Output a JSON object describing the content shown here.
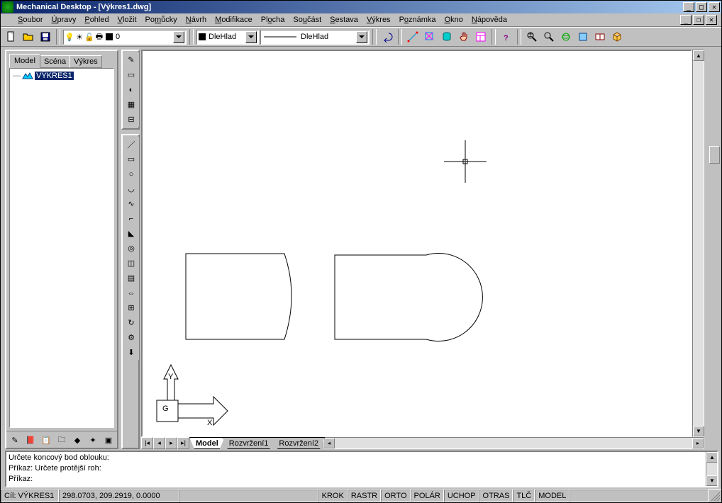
{
  "window": {
    "title": "Mechanical Desktop - [Výkres1.dwg]"
  },
  "menu": {
    "items": [
      "Soubor",
      "Úpravy",
      "Pohled",
      "Vložit",
      "Pomůcky",
      "Návrh",
      "Modifikace",
      "Plocha",
      "Součást",
      "Sestava",
      "Výkres",
      "Poznámka",
      "Okno",
      "Nápověda"
    ],
    "accel": [
      0,
      0,
      0,
      0,
      0,
      0,
      0,
      0,
      0,
      0,
      0,
      0,
      0,
      0
    ]
  },
  "toolbars": {
    "layer_combo": "0",
    "style_combo": "DleHlad",
    "linetype_combo": "DleHlad"
  },
  "browser": {
    "tabs": [
      "Model",
      "Scéna",
      "Výkres"
    ],
    "active_tab": 0,
    "tree": {
      "root": "VÝKRES1"
    }
  },
  "sheets": {
    "tabs": [
      "Model",
      "Rozvržení1",
      "Rozvržení2"
    ],
    "active": 0
  },
  "command": {
    "line1": "Určete koncový bod oblouku:",
    "line2": "Příkaz: Určete protější roh:",
    "line3": "Příkaz:"
  },
  "status": {
    "target": "Cíl: VÝKRES1",
    "coords": "298.0703, 209.2919, 0.0000",
    "toggles": [
      "KROK",
      "RASTR",
      "ORTO",
      "POLÁR",
      "UCHOP",
      "OTRAS",
      "TLČ",
      "MODEL"
    ]
  },
  "ucs": {
    "x": "X",
    "y": "Y",
    "g": "G"
  }
}
